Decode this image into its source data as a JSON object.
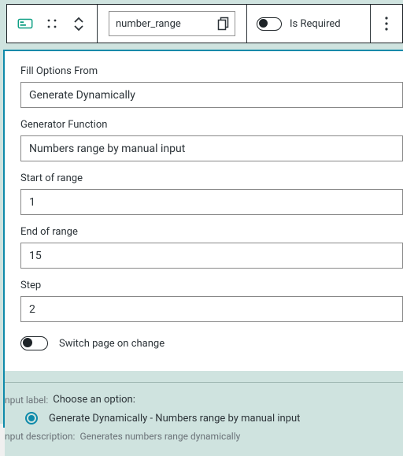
{
  "toolbar": {
    "field_name": "number_range",
    "is_required_label": "Is Required"
  },
  "form": {
    "fill_options": {
      "label": "Fill Options From",
      "value": "Generate Dynamically"
    },
    "generator": {
      "label": "Generator Function",
      "value": "Numbers range by manual input"
    },
    "start": {
      "label": "Start of range",
      "value": "1"
    },
    "end": {
      "label": "End of range",
      "value": "15"
    },
    "step": {
      "label": "Step",
      "value": "2"
    },
    "switch_label": "Switch page on change"
  },
  "footer": {
    "input_label_caption": "nput label:",
    "input_label_value": "Choose an option:",
    "option_text": "Generate Dynamically - Numbers range by manual input",
    "input_desc_caption": "nput description:",
    "input_desc_value": "Generates numbers range dynamically"
  }
}
